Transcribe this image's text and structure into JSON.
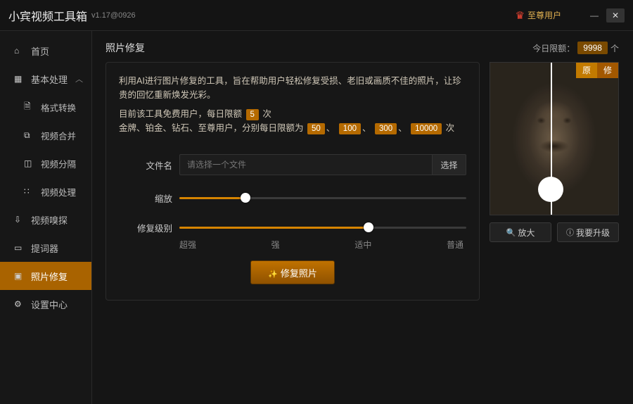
{
  "app": {
    "title": "小宾视频工具箱",
    "version": "v1.17@0926"
  },
  "user": {
    "tier": "至尊用户"
  },
  "sidebar": {
    "home": "首页",
    "basic": "基本处理",
    "items": [
      {
        "label": "格式转换"
      },
      {
        "label": "视频合并"
      },
      {
        "label": "视频分隔"
      },
      {
        "label": "视频处理"
      }
    ],
    "sniff": "视频嗅探",
    "teleprompter": "提词器",
    "photo_repair": "照片修复",
    "settings": "设置中心"
  },
  "panel": {
    "title": "照片修复",
    "quota_label": "今日限额：",
    "quota_value": "9998",
    "quota_unit": "个"
  },
  "desc": {
    "line1": "利用AI进行图片修复的工具，旨在帮助用户轻松修复受损、老旧或画质不佳的照片，让珍贵的回忆重新焕发光彩。",
    "line2a": "目前该工具免费用户，每日限额",
    "free_limit": "5",
    "line2b": "次",
    "line3a": "金牌、铂金、钻石、至尊用户，分别每日限额为",
    "t1": "50",
    "t2": "100",
    "t3": "300",
    "t4": "10000",
    "line3b": "次"
  },
  "form": {
    "file_label": "文件名",
    "file_placeholder": "请选择一个文件",
    "pick": "选择",
    "zoom_label": "缩放",
    "level_label": "修复级别",
    "ticks": [
      "超强",
      "强",
      "适中",
      "普通"
    ],
    "submit": "修复照片"
  },
  "preview": {
    "orig": "原",
    "fixed": "修",
    "zoom_in": "放大",
    "upgrade": "我要升级"
  }
}
